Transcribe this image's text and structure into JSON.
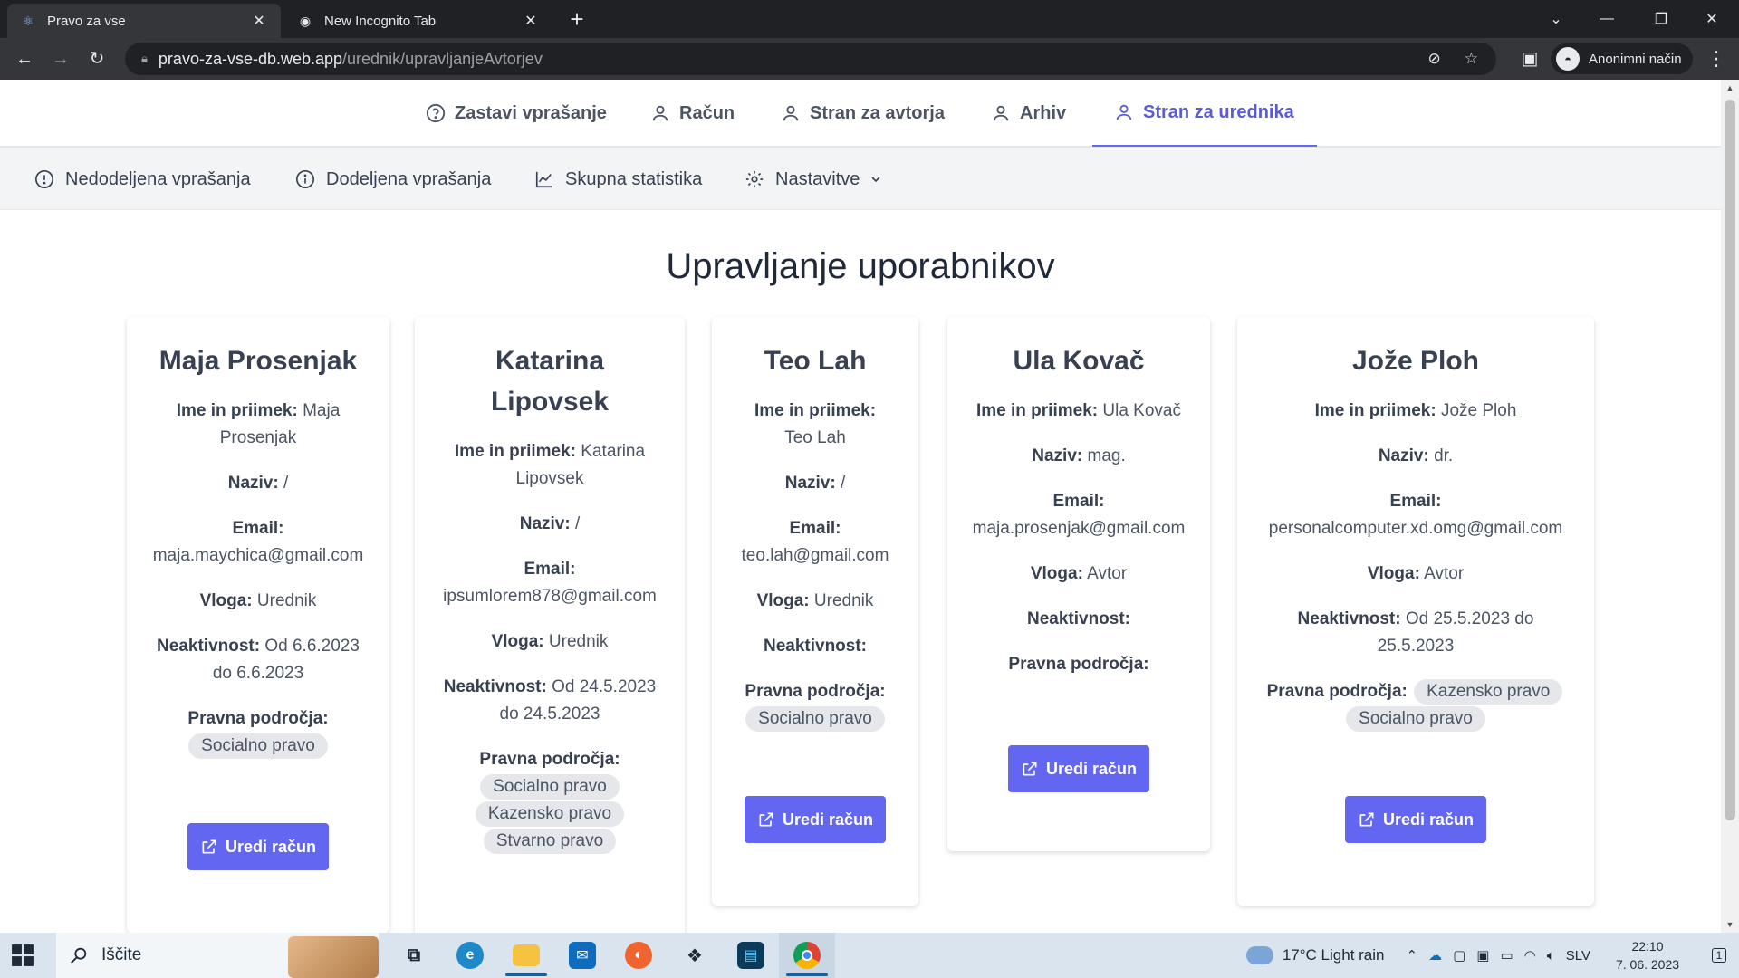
{
  "browser": {
    "tabs": [
      {
        "title": "Pravo za vse",
        "active": true
      },
      {
        "title": "New Incognito Tab",
        "active": false
      }
    ],
    "url_host": "pravo-za-vse-db.web.app",
    "url_path": "/urednik/upravljanjeAvtorjev",
    "incognito_label": "Anonimni način"
  },
  "topnav": [
    {
      "label": "Zastavi vprašanje",
      "icon": "question-circle-icon"
    },
    {
      "label": "Račun",
      "icon": "user-icon"
    },
    {
      "label": "Stran za avtorja",
      "icon": "user-icon"
    },
    {
      "label": "Arhiv",
      "icon": "user-icon"
    },
    {
      "label": "Stran za urednika",
      "icon": "user-icon",
      "active": true
    }
  ],
  "subnav": [
    {
      "label": "Nedodeljena vprašanja",
      "icon": "exclamation-circle-icon"
    },
    {
      "label": "Dodeljena vprašanja",
      "icon": "info-circle-icon"
    },
    {
      "label": "Skupna statistika",
      "icon": "chart-line-icon"
    },
    {
      "label": "Nastavitve",
      "icon": "gear-icon"
    }
  ],
  "page_title": "Upravljanje uporabnikov",
  "labels": {
    "name": "Ime in priimek:",
    "title": "Naziv:",
    "email": "Email:",
    "role": "Vloga:",
    "inactive": "Neaktivnost:",
    "areas": "Pravna področja:",
    "edit": "Uredi račun"
  },
  "users": [
    {
      "heading": "Maja Prosenjak",
      "name": "Maja Prosenjak",
      "title": "/",
      "email": "maja.maychica@gmail.com",
      "role": "Urednik",
      "inactive": "Od 6.6.2023 do 6.6.2023",
      "areas": [
        "Socialno pravo"
      ]
    },
    {
      "heading": "Katarina Lipovsek",
      "name": "Katarina Lipovsek",
      "title": "/",
      "email": "ipsumlorem878@gmail.com",
      "role": "Urednik",
      "inactive": "Od 24.5.2023 do 24.5.2023",
      "areas": [
        "Socialno pravo",
        "Kazensko pravo",
        "Stvarno pravo"
      ]
    },
    {
      "heading": "Teo Lah",
      "name": "Teo Lah",
      "title": "/",
      "email": "teo.lah@gmail.com",
      "role": "Urednik",
      "inactive": "",
      "areas": [
        "Socialno pravo"
      ]
    },
    {
      "heading": "Ula Kovač",
      "name": "Ula Kovač",
      "title": "mag.",
      "email": "maja.prosenjak@gmail.com",
      "role": "Avtor",
      "inactive": "",
      "areas": []
    },
    {
      "heading": "Jože Ploh",
      "name": "Jože Ploh",
      "title": "dr.",
      "email": "personalcomputer.xd.omg@gmail.com",
      "role": "Avtor",
      "inactive": "Od 25.5.2023 do 25.5.2023",
      "areas": [
        "Kazensko pravo",
        "Socialno pravo"
      ]
    }
  ],
  "taskbar": {
    "search_placeholder": "Iščite",
    "weather": "17°C  Light rain",
    "language": "SLV",
    "time": "22:10",
    "date": "7. 06. 2023",
    "notifications": "1"
  },
  "colors": {
    "accent": "#6366f1",
    "chip": "#e5e7eb",
    "subnav_bg": "#f3f4f6"
  }
}
